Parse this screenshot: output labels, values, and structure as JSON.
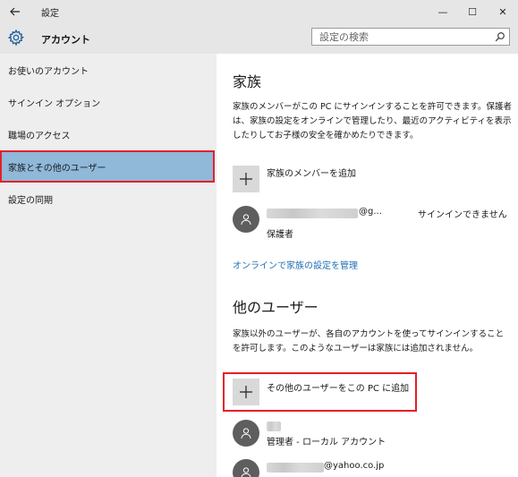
{
  "titlebar": {
    "title": "設定",
    "back_icon": "back-arrow-icon",
    "minimize_symbol": "—",
    "maximize_symbol": "☐",
    "close_symbol": "✕"
  },
  "header": {
    "title": "アカウント",
    "icon": "gear-icon",
    "search_placeholder": "設定の検索"
  },
  "sidebar": {
    "items": [
      {
        "label": "お使いのアカウント",
        "selected": false
      },
      {
        "label": "サインイン オプション",
        "selected": false
      },
      {
        "label": "職場のアクセス",
        "selected": false
      },
      {
        "label": "家族とその他のユーザー",
        "selected": true
      },
      {
        "label": "設定の同期",
        "selected": false
      }
    ]
  },
  "family": {
    "title": "家族",
    "description": "家族のメンバーがこの PC にサインインすることを許可できます。保護者は、家族の設定をオンラインで管理したり、最近のアクティビティを表示したりしてお子様の安全を確かめたりできます。",
    "add_label": "家族のメンバーを追加",
    "member": {
      "email_suffix": "@g...",
      "status": "サインインできません",
      "role": "保護者"
    },
    "manage_link": "オンラインで家族の設定を管理"
  },
  "others": {
    "title": "他のユーザー",
    "description": "家族以外のユーザーが、各自のアカウントを使ってサインインすることを許可します。このようなユーザーは家族には追加されません。",
    "add_label": "その他のユーザーをこの PC に追加",
    "users": [
      {
        "role": "管理者 - ローカル アカウント"
      },
      {
        "email_suffix": "@yahoo.co.jp"
      }
    ]
  },
  "colors": {
    "chrome_bg": "#e6e6e6",
    "sidebar_bg": "#eeeeee",
    "selected_bg": "#8fb8d9",
    "highlight_red": "#e3202b",
    "link": "#1f6fb5"
  }
}
